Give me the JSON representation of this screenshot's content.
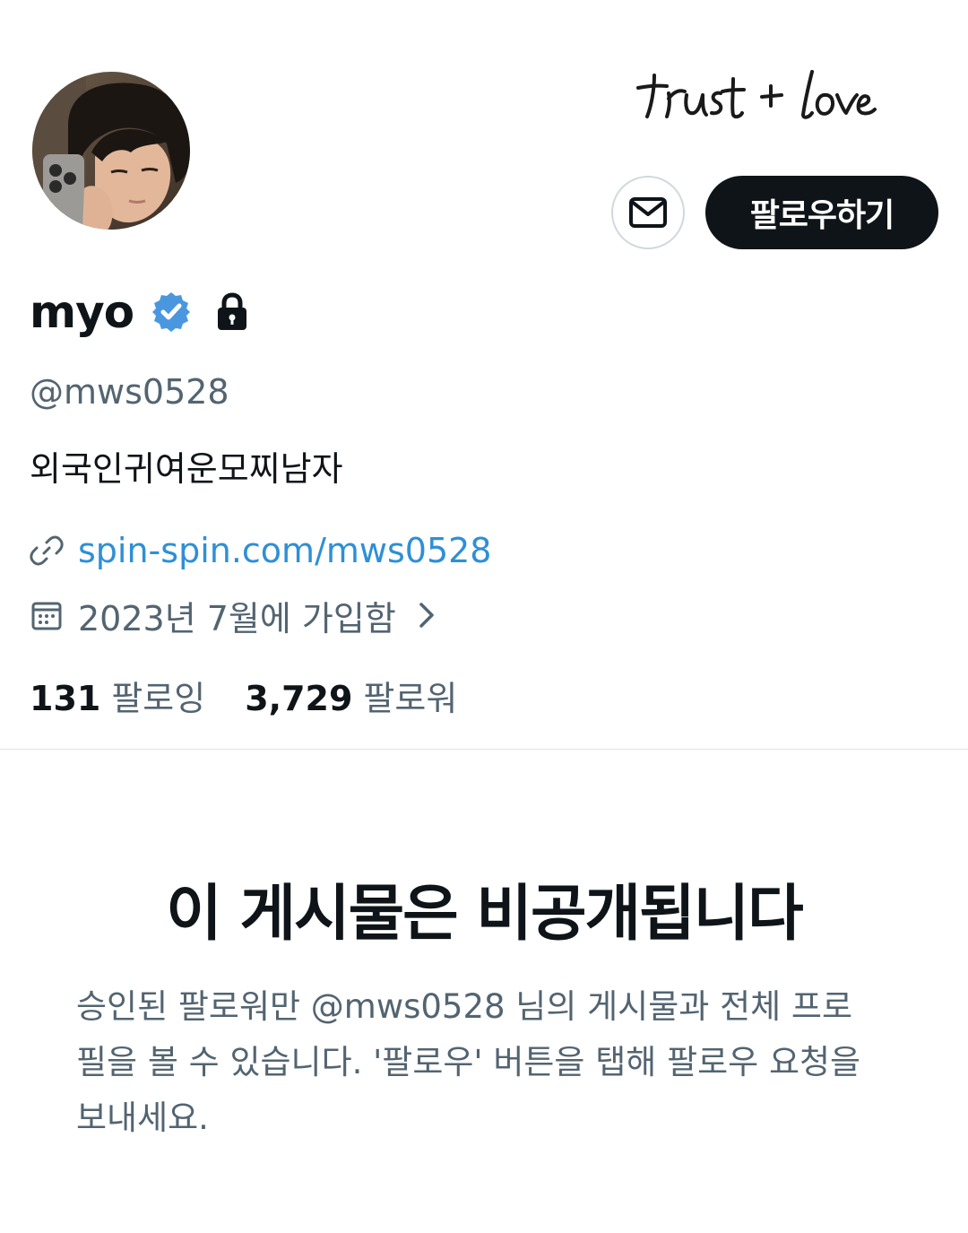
{
  "banner": {
    "handwriting_text": "trust + love"
  },
  "profile": {
    "display_name": "myo",
    "handle": "@mws0528",
    "bio": "외국인귀여운모찌남자",
    "link": "spin-spin.com/mws0528",
    "joined": "2023년 7월에 가입함",
    "verified": true,
    "protected": true
  },
  "actions": {
    "message_icon": "mail-icon",
    "follow_label": "팔로우하기"
  },
  "stats": {
    "following_count": "131",
    "following_label": "팔로잉",
    "followers_count": "3,729",
    "followers_label": "팔로워"
  },
  "private_notice": {
    "title": "이 게시물은 비공개됩니다",
    "description": "승인된 팔로워만 @mws0528 님의 게시물과 전체 프로필을 볼 수 있습니다. '팔로우' 버튼을 탭해 팔로우 요청을 보내세요."
  },
  "colors": {
    "text_primary": "#0f1419",
    "text_secondary": "#536471",
    "link": "#2e8fd6",
    "verified_badge": "#4a97e0",
    "button_dark": "#0f1419"
  }
}
